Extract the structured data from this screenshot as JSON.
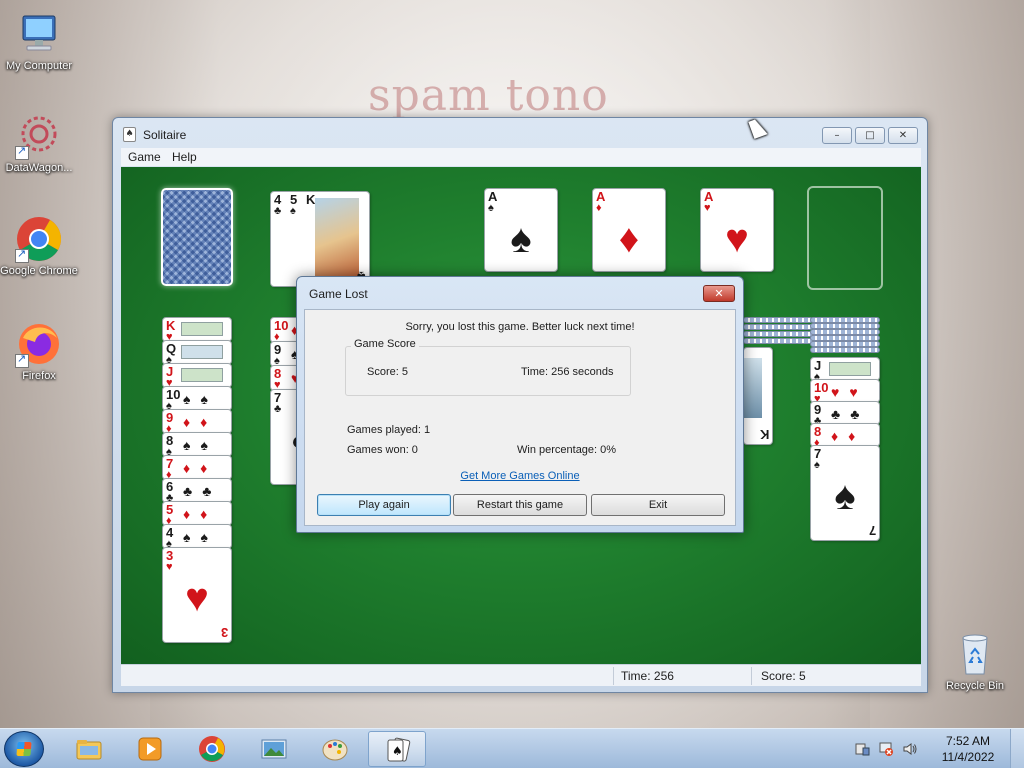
{
  "desktop": {
    "wallpaper_text": "spam tono",
    "icons": [
      {
        "label": "My Computer"
      },
      {
        "label": "DataWagon..."
      },
      {
        "label": "Google Chrome"
      },
      {
        "label": "Firefox"
      },
      {
        "label": "Recycle Bin"
      }
    ]
  },
  "window": {
    "title": "Solitaire",
    "menu": [
      "Game",
      "Help"
    ],
    "status": {
      "time": "Time:  256",
      "score": "Score: 5"
    }
  },
  "cards": {
    "waste": [
      {
        "rank": "4",
        "suit": "♣",
        "color": "black"
      },
      {
        "rank": "5",
        "suit": "♠",
        "color": "black"
      },
      {
        "rank": "K",
        "suit": "♣",
        "color": "black"
      }
    ],
    "foundations": [
      {
        "rank": "A",
        "suit": "♠",
        "color": "black"
      },
      {
        "rank": "A",
        "suit": "♦",
        "color": "red"
      },
      {
        "rank": "A",
        "suit": "♥",
        "color": "red"
      }
    ],
    "column1": [
      {
        "rank": "K",
        "suit": "♥",
        "color": "red"
      },
      {
        "rank": "Q",
        "suit": "♠",
        "color": "black"
      },
      {
        "rank": "J",
        "suit": "♥",
        "color": "red"
      },
      {
        "rank": "10",
        "suit": "♠",
        "color": "black"
      },
      {
        "rank": "9",
        "suit": "♦",
        "color": "red"
      },
      {
        "rank": "8",
        "suit": "♠",
        "color": "black"
      },
      {
        "rank": "7",
        "suit": "♦",
        "color": "red"
      },
      {
        "rank": "6",
        "suit": "♣",
        "color": "black"
      },
      {
        "rank": "5",
        "suit": "♦",
        "color": "red"
      },
      {
        "rank": "4",
        "suit": "♠",
        "color": "black"
      },
      {
        "rank": "3",
        "suit": "♥",
        "color": "red"
      }
    ],
    "column2": [
      {
        "rank": "10",
        "suit": "♦",
        "color": "red"
      },
      {
        "rank": "9",
        "suit": "♠",
        "color": "black"
      },
      {
        "rank": "8",
        "suit": "♥",
        "color": "red"
      },
      {
        "rank": "7",
        "suit": "♣",
        "color": "black"
      }
    ],
    "column3_top": {
      "rank": "K",
      "suit": "♠",
      "color": "black"
    },
    "column4": [
      {
        "rank": "J",
        "suit": "♠",
        "color": "black"
      },
      {
        "rank": "10",
        "suit": "♥",
        "color": "red"
      },
      {
        "rank": "9",
        "suit": "♣",
        "color": "black"
      },
      {
        "rank": "8",
        "suit": "♦",
        "color": "red"
      },
      {
        "rank": "7",
        "suit": "♠",
        "color": "black"
      }
    ]
  },
  "dialog": {
    "title": "Game Lost",
    "close": "✕",
    "message": "Sorry, you lost this game. Better luck next time!",
    "group_label": "Game Score",
    "score": "Score: 5",
    "time": "Time:  256  seconds",
    "games_played": "Games played: 1",
    "games_won": "Games won: 0",
    "win_percentage": "Win percentage: 0%",
    "link": "Get More Games Online",
    "buttons": {
      "play_again": "Play again",
      "restart": "Restart this game",
      "exit": "Exit"
    }
  },
  "taskbar": {
    "clock_time": "7:52 AM",
    "clock_date": "11/4/2022"
  },
  "colors": {
    "felt": "#1f7f2e",
    "red_suit": "#d1141a",
    "link": "#0a5fb7"
  }
}
